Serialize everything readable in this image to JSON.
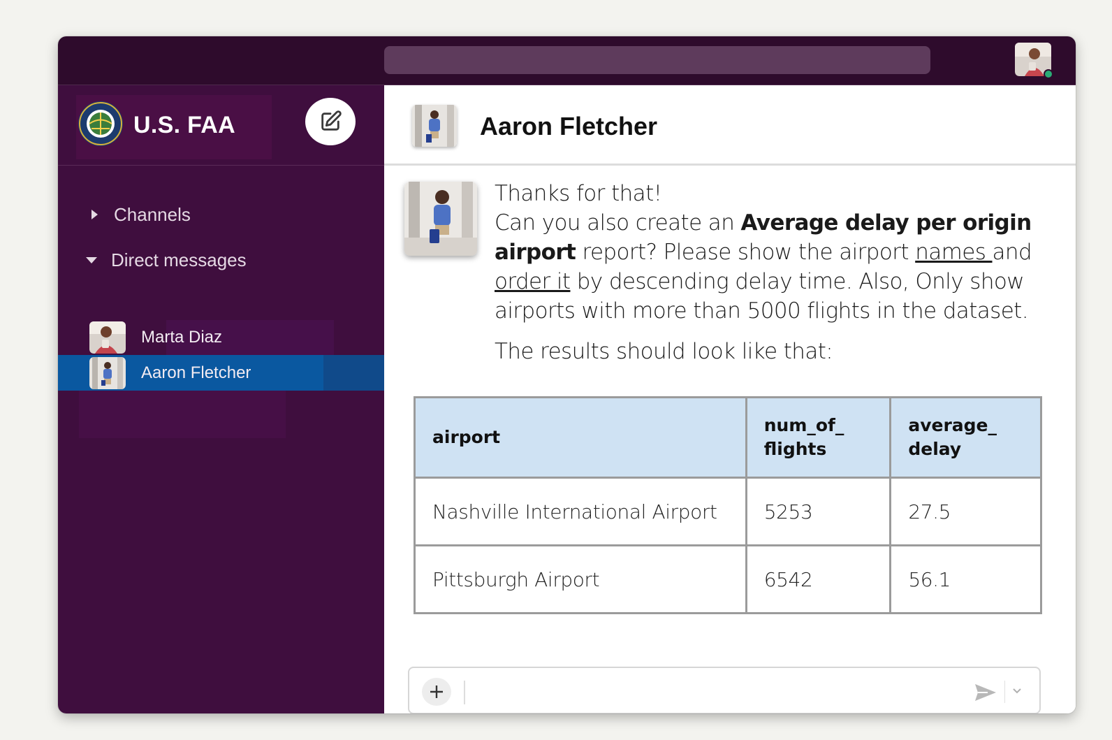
{
  "workspace": {
    "name": "U.S. FAA"
  },
  "sidebar": {
    "sections": [
      {
        "label": "Channels",
        "collapsed": true
      },
      {
        "label": "Direct messages",
        "collapsed": false
      }
    ],
    "direct_messages": [
      {
        "name": "Marta Diaz",
        "active": false
      },
      {
        "name": "Aaron Fletcher",
        "active": true
      }
    ]
  },
  "conversation": {
    "title": "Aaron Fletcher",
    "message": {
      "line1": "Thanks for that!",
      "p_start": "Can you also create an ",
      "p_bold": "Average delay per origin airport",
      "p_mid": " report? Please show the airport ",
      "p_u1": "names ",
      "p_and": "and ",
      "p_u2": "order it",
      "p_end": " by descending delay time. Also, Only show airports with more than 5000 flights in the dataset.",
      "line3": "The results should look like that:"
    },
    "table": {
      "headers": [
        "airport",
        "num_of_ flights",
        "average_ delay"
      ],
      "rows": [
        [
          "Nashville International Airport",
          "5253",
          "27.5"
        ],
        [
          "Pittsburgh Airport",
          "6542",
          "56.1"
        ]
      ]
    }
  },
  "icons": {
    "compose": "compose-icon",
    "send": "send-icon",
    "plus": "plus-icon",
    "chevron": "chevron-down-icon"
  },
  "colors": {
    "topbar": "#2e0b2c",
    "sidebar": "#3f0e3e",
    "active_item": "#0a58a0",
    "table_header": "#cfe2f3"
  }
}
